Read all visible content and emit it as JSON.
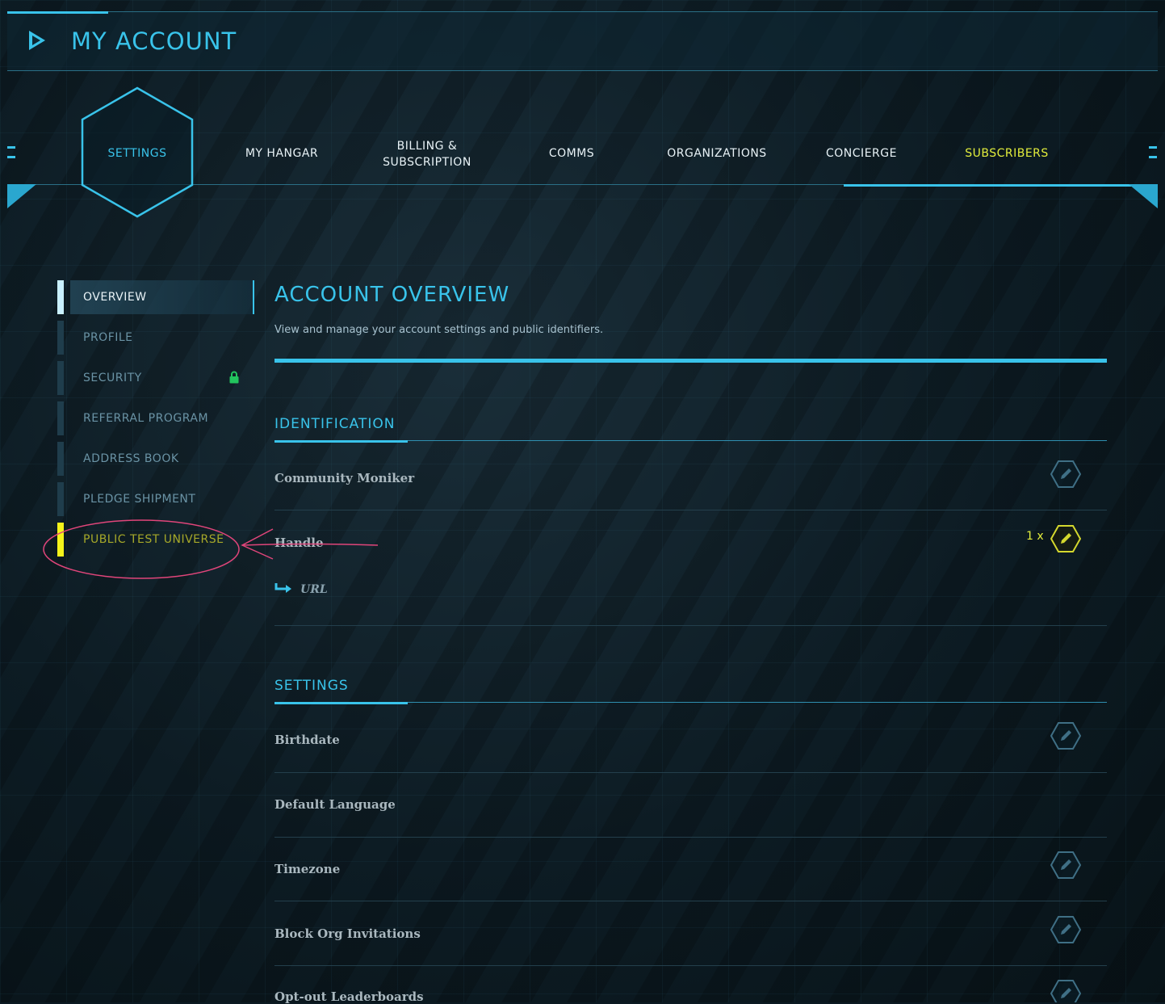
{
  "header": {
    "title": "MY ACCOUNT"
  },
  "nav": {
    "items": [
      {
        "label": "SETTINGS",
        "active": true
      },
      {
        "label": "MY HANGAR"
      },
      {
        "label": "BILLING &",
        "label2": "SUBSCRIPTION"
      },
      {
        "label": "COMMS"
      },
      {
        "label": "ORGANIZATIONS"
      },
      {
        "label": "CONCIERGE"
      },
      {
        "label": "SUBSCRIBERS",
        "highlight": true
      }
    ]
  },
  "sidebar": {
    "items": [
      {
        "label": "OVERVIEW",
        "active": true
      },
      {
        "label": "PROFILE"
      },
      {
        "label": "SECURITY",
        "icon": "lock-icon"
      },
      {
        "label": "REFERRAL PROGRAM"
      },
      {
        "label": "ADDRESS BOOK"
      },
      {
        "label": "PLEDGE SHIPMENT"
      },
      {
        "label": "PUBLIC TEST UNIVERSE",
        "highlight": true
      }
    ]
  },
  "main": {
    "title": "ACCOUNT OVERVIEW",
    "description": "View and manage your account settings and public identifiers.",
    "identification": {
      "title": "IDENTIFICATION",
      "rows": [
        {
          "label": "Community Moniker",
          "editable": true
        },
        {
          "label": "Handle",
          "editable": true,
          "counter": "1 x"
        }
      ],
      "url_label": "URL"
    },
    "settings": {
      "title": "SETTINGS",
      "rows": [
        {
          "label": "Birthdate",
          "editable": true
        },
        {
          "label": "Default Language",
          "editable": false
        },
        {
          "label": "Timezone",
          "editable": true
        },
        {
          "label": "Block Org Invitations",
          "editable": true
        },
        {
          "label": "Opt-out Leaderboards",
          "editable": true
        }
      ]
    }
  },
  "colors": {
    "accent": "#39c3ea",
    "highlight": "#e3ee3c",
    "ptu_bar": "#f4f31a",
    "lock": "#22c55e",
    "annotation": "#e0457a"
  }
}
